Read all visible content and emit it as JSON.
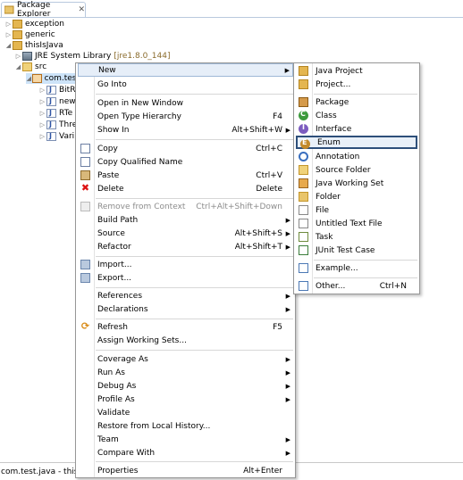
{
  "view": {
    "title": "Package Explorer",
    "close_glyph": "✕",
    "tree": [
      {
        "label": "exception",
        "twisty": "▷",
        "icon": "project-icon"
      },
      {
        "label": "generic",
        "twisty": "▷",
        "icon": "project-icon"
      },
      {
        "label": "thisIsJava",
        "twisty": "◢",
        "icon": "project-icon"
      },
      {
        "label": "JRE System Library",
        "decoration": "[jre1.8.0_144]",
        "twisty": "▷",
        "icon": "library-icon"
      },
      {
        "label": "src",
        "twisty": "◢",
        "icon": "source-folder-icon"
      },
      {
        "label": "com.test",
        "twisty": "◢",
        "icon": "package-icon"
      },
      {
        "label": "BitR",
        "twisty": "▷",
        "icon": "java-file-icon"
      },
      {
        "label": "new",
        "twisty": "▷",
        "icon": "java-file-icon"
      },
      {
        "label": "RTe",
        "twisty": "▷",
        "icon": "java-file-icon"
      },
      {
        "label": "Thre",
        "twisty": "▷",
        "icon": "java-file-icon"
      },
      {
        "label": "Vari",
        "twisty": "▷",
        "icon": "java-file-icon"
      }
    ],
    "status": "com.test.java - thisIsJava"
  },
  "context_menu": {
    "items": [
      {
        "label": "New",
        "arrow": "▶"
      },
      {
        "label": "Go Into"
      },
      {
        "label": "Open in New Window"
      },
      {
        "label": "Open Type Hierarchy",
        "accel": "F4"
      },
      {
        "label": "Show In",
        "accel": "Alt+Shift+W",
        "arrow": "▶"
      },
      {
        "label": "Copy",
        "accel": "Ctrl+C"
      },
      {
        "label": "Copy Qualified Name"
      },
      {
        "label": "Paste",
        "accel": "Ctrl+V"
      },
      {
        "label": "Delete",
        "accel": "Delete"
      },
      {
        "label": "Remove from Context",
        "accel": "Ctrl+Alt+Shift+Down"
      },
      {
        "label": "Build Path",
        "arrow": "▶"
      },
      {
        "label": "Source",
        "accel": "Alt+Shift+S",
        "arrow": "▶"
      },
      {
        "label": "Refactor",
        "accel": "Alt+Shift+T",
        "arrow": "▶"
      },
      {
        "label": "Import..."
      },
      {
        "label": "Export..."
      },
      {
        "label": "References",
        "arrow": "▶"
      },
      {
        "label": "Declarations",
        "arrow": "▶"
      },
      {
        "label": "Refresh",
        "accel": "F5"
      },
      {
        "label": "Assign Working Sets..."
      },
      {
        "label": "Coverage As",
        "arrow": "▶"
      },
      {
        "label": "Run As",
        "arrow": "▶"
      },
      {
        "label": "Debug As",
        "arrow": "▶"
      },
      {
        "label": "Profile As",
        "arrow": "▶"
      },
      {
        "label": "Validate"
      },
      {
        "label": "Restore from Local History..."
      },
      {
        "label": "Team",
        "arrow": "▶"
      },
      {
        "label": "Compare With",
        "arrow": "▶"
      },
      {
        "label": "Properties",
        "accel": "Alt+Enter"
      }
    ]
  },
  "submenu": {
    "items": [
      {
        "label": "Java Project"
      },
      {
        "label": "Project..."
      },
      {
        "label": "Package"
      },
      {
        "label": "Class"
      },
      {
        "label": "Interface"
      },
      {
        "label": "Enum"
      },
      {
        "label": "Annotation"
      },
      {
        "label": "Source Folder"
      },
      {
        "label": "Java Working Set"
      },
      {
        "label": "Folder"
      },
      {
        "label": "File"
      },
      {
        "label": "Untitled Text File"
      },
      {
        "label": "Task"
      },
      {
        "label": "JUnit Test Case"
      },
      {
        "label": "Example..."
      },
      {
        "label": "Other...",
        "accel": "Ctrl+N"
      }
    ],
    "highlighted": "Enum"
  },
  "colors": {
    "highlight_border": "#2e4f7a",
    "selection": "#cde3f8",
    "menu_border": "#979797"
  }
}
